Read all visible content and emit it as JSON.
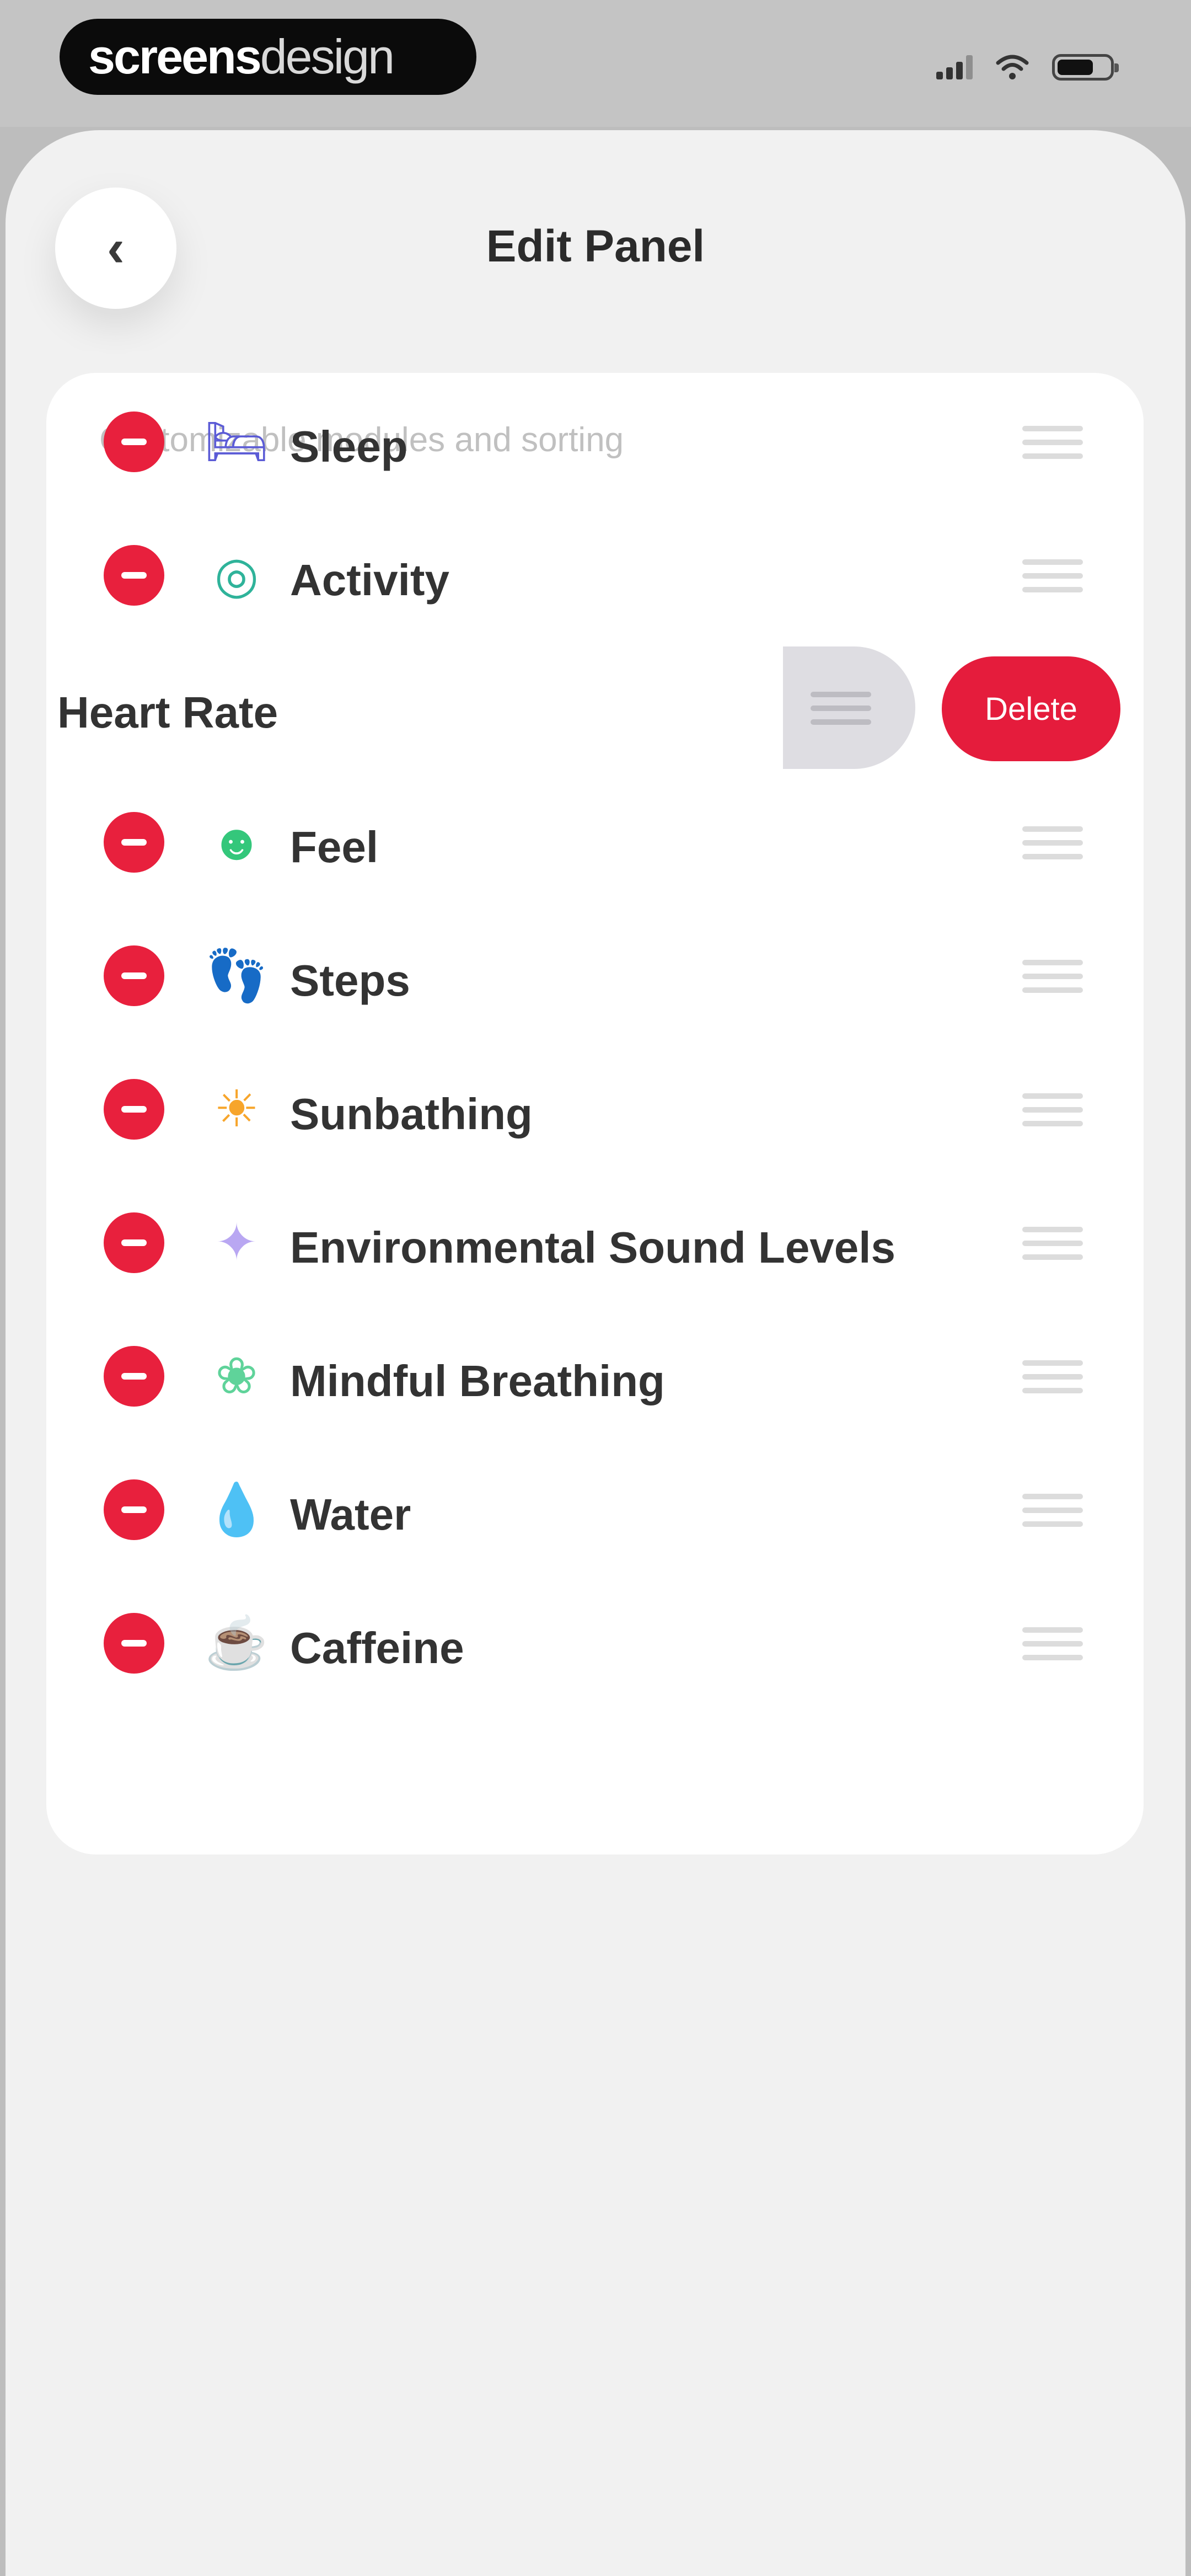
{
  "status_bar": {
    "brand_bold": "screens",
    "brand_light": "design",
    "icons": [
      "cellular-signal-icon",
      "wifi-icon",
      "battery-icon"
    ]
  },
  "header": {
    "back_icon": "chevron-left-icon",
    "back_glyph": "‹",
    "title": "Edit Panel"
  },
  "panel": {
    "caption": "Customizable modules and sorting",
    "modules": [
      {
        "label": "Sleep",
        "icon": "bed-icon",
        "glyph": "🛏",
        "color": "#5b5bd6"
      },
      {
        "label": "Activity",
        "icon": "activity-rings-icon",
        "glyph": "◎",
        "color": "#2fb39a"
      },
      {
        "label": "Heart Rate",
        "icon": "heart-icon",
        "swiped": true
      },
      {
        "label": "Feel",
        "icon": "smiley-face-icon",
        "glyph": "☻",
        "color": "#34c77b"
      },
      {
        "label": "Steps",
        "icon": "footprints-icon",
        "glyph": "👣",
        "color": "#ef6a2e"
      },
      {
        "label": "Sunbathing",
        "icon": "sun-icon",
        "glyph": "☀",
        "color": "#f7a52b"
      },
      {
        "label": "Environmental Sound Levels",
        "icon": "sparkle-icon",
        "glyph": "✦",
        "color": "#b9a7f2"
      },
      {
        "label": "Mindful Breathing",
        "icon": "lotus-icon",
        "glyph": "❀",
        "color": "#5fd39a"
      },
      {
        "label": "Water",
        "icon": "water-drop-icon",
        "glyph": "💧",
        "color": "#3f7be8"
      },
      {
        "label": "Caffeine",
        "icon": "coffee-cup-icon",
        "glyph": "☕",
        "color": "#8b6a52"
      }
    ],
    "delete_label": "Delete"
  },
  "colors": {
    "accent_red": "#e8203d",
    "sheet_bg": "#f1f1f1",
    "card_bg": "#ffffff"
  }
}
